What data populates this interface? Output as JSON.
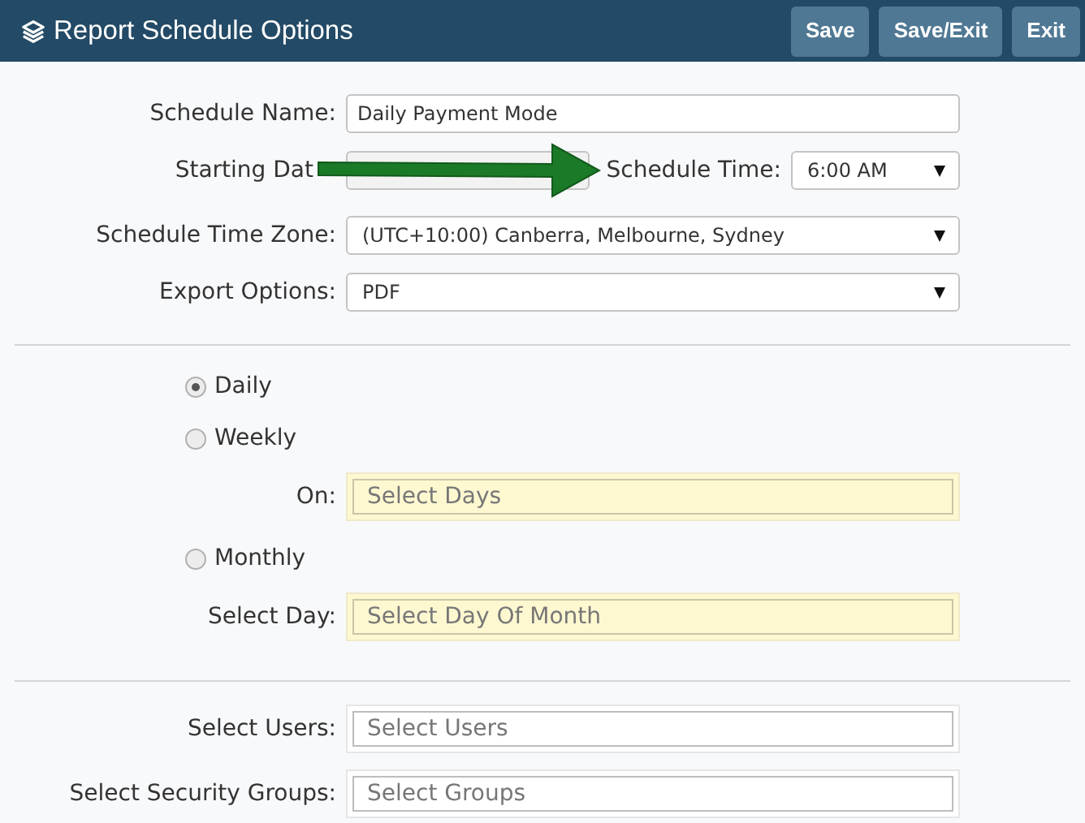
{
  "header": {
    "title": "Report Schedule Options",
    "buttons": [
      "Save",
      "Save/Exit",
      "Exit"
    ]
  },
  "schedule_name": {
    "label": "Schedule Name:",
    "value": "Daily Payment Mode"
  },
  "starting_date": {
    "label": "Starting Dat"
  },
  "schedule_time": {
    "label": "Schedule Time:",
    "value": "6:00 AM"
  },
  "time_zone": {
    "label": "Schedule Time Zone:",
    "value": "(UTC+10:00) Canberra, Melbourne, Sydney"
  },
  "export_options": {
    "label": "Export Options:",
    "value": "PDF"
  },
  "recurrence": [
    {
      "label": "Daily",
      "selected": true
    },
    {
      "label": "Weekly",
      "selected": false,
      "field": {
        "label": "On:",
        "placeholder": "Select Days"
      }
    },
    {
      "label": "Monthly",
      "selected": false,
      "field": {
        "label": "Select Day:",
        "placeholder": "Select Day Of Month"
      }
    }
  ],
  "recipients": [
    {
      "label": "Select Users:",
      "placeholder": "Select Users"
    },
    {
      "label": "Select Security Groups:",
      "placeholder": "Select Groups"
    }
  ]
}
